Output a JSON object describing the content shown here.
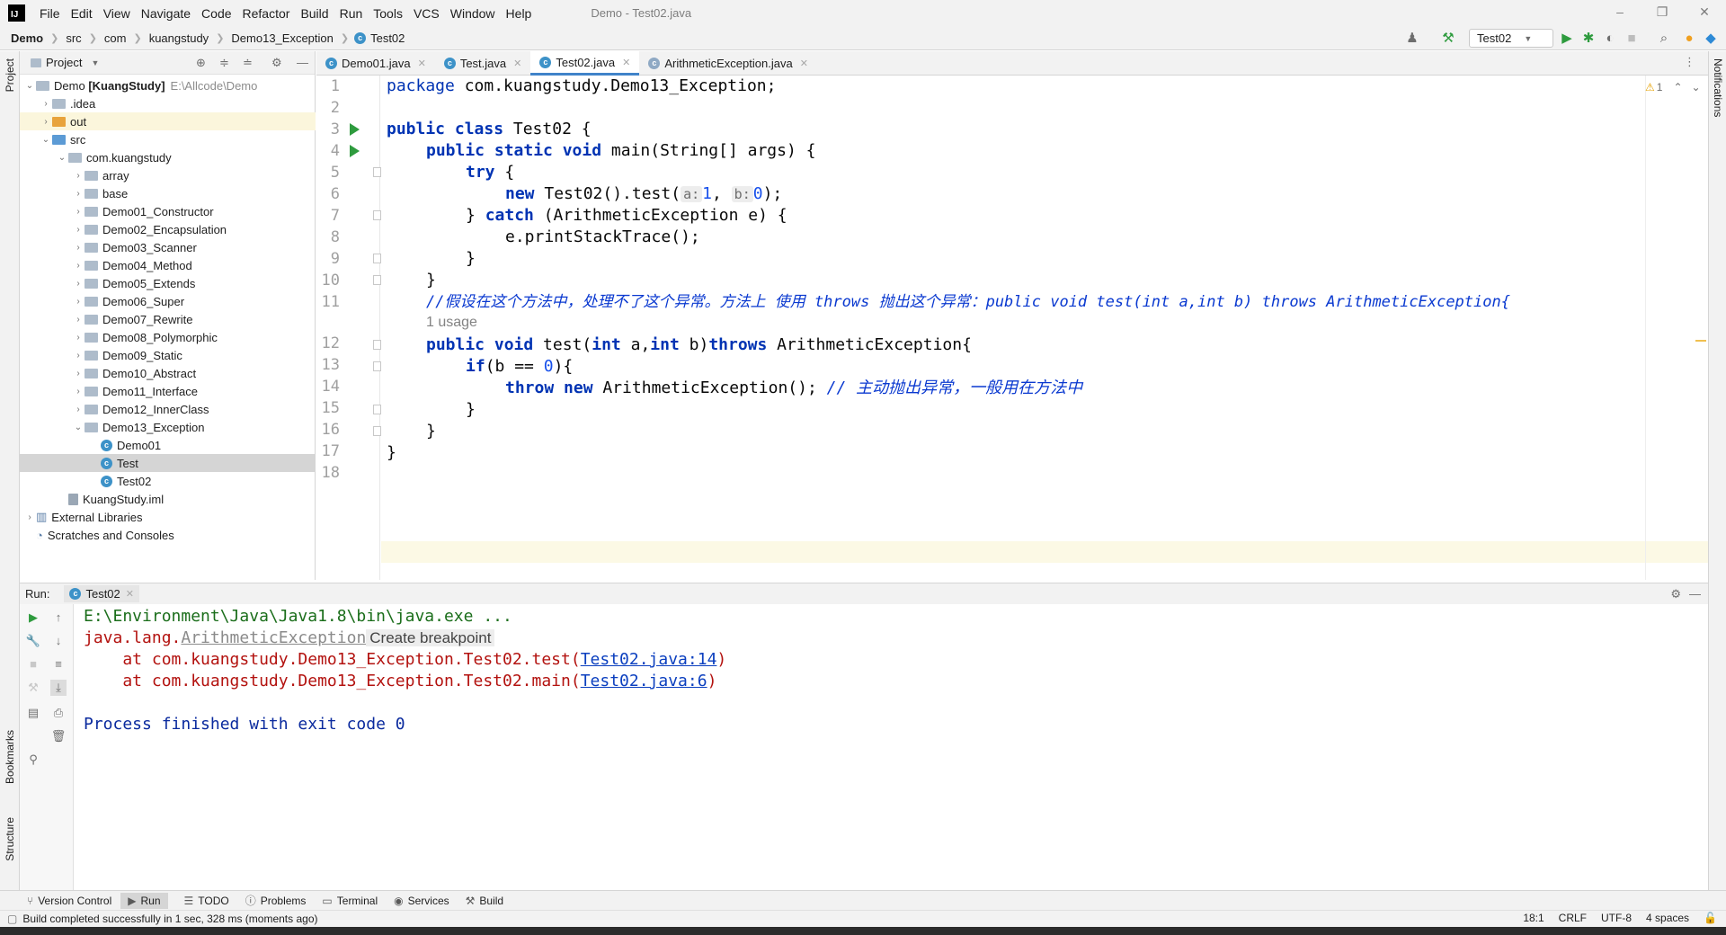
{
  "menu": {
    "items": [
      "File",
      "Edit",
      "View",
      "Navigate",
      "Code",
      "Refactor",
      "Build",
      "Run",
      "Tools",
      "VCS",
      "Window",
      "Help"
    ],
    "title": "Demo - Test02.java"
  },
  "breadcrumbs": [
    "Demo",
    "src",
    "com",
    "kuangstudy",
    "Demo13_Exception",
    "Test02"
  ],
  "toolbar": {
    "run_config": "Test02"
  },
  "left_strip": {
    "project": "Project",
    "bookmarks": "Bookmarks",
    "structure": "Structure"
  },
  "right_strip": {
    "notifications": "Notifications"
  },
  "project": {
    "header": "Project",
    "root": {
      "name": "Demo",
      "module": "[KuangStudy]",
      "path": "E:\\Allcode\\Demo"
    },
    "tree": [
      {
        "label": ".idea",
        "level": 1,
        "kind": "folder-gray",
        "arrow": "›"
      },
      {
        "label": "out",
        "level": 1,
        "kind": "folder-orange",
        "arrow": "›"
      },
      {
        "label": "src",
        "level": 1,
        "kind": "folder-blue",
        "arrow": "⌄"
      },
      {
        "label": "com.kuangstudy",
        "level": 2,
        "kind": "folder-gray",
        "arrow": "⌄"
      },
      {
        "label": "array",
        "level": 3,
        "kind": "folder-gray",
        "arrow": "›"
      },
      {
        "label": "base",
        "level": 3,
        "kind": "folder-gray",
        "arrow": "›"
      },
      {
        "label": "Demo01_Constructor",
        "level": 3,
        "kind": "folder-gray",
        "arrow": "›"
      },
      {
        "label": "Demo02_Encapsulation",
        "level": 3,
        "kind": "folder-gray",
        "arrow": "›"
      },
      {
        "label": "Demo03_Scanner",
        "level": 3,
        "kind": "folder-gray",
        "arrow": "›"
      },
      {
        "label": "Demo04_Method",
        "level": 3,
        "kind": "folder-gray",
        "arrow": "›"
      },
      {
        "label": "Demo05_Extends",
        "level": 3,
        "kind": "folder-gray",
        "arrow": "›"
      },
      {
        "label": "Demo06_Super",
        "level": 3,
        "kind": "folder-gray",
        "arrow": "›"
      },
      {
        "label": "Demo07_Rewrite",
        "level": 3,
        "kind": "folder-gray",
        "arrow": "›"
      },
      {
        "label": "Demo08_Polymorphic",
        "level": 3,
        "kind": "folder-gray",
        "arrow": "›"
      },
      {
        "label": "Demo09_Static",
        "level": 3,
        "kind": "folder-gray",
        "arrow": "›"
      },
      {
        "label": "Demo10_Abstract",
        "level": 3,
        "kind": "folder-gray",
        "arrow": "›"
      },
      {
        "label": "Demo11_Interface",
        "level": 3,
        "kind": "folder-gray",
        "arrow": "›"
      },
      {
        "label": "Demo12_InnerClass",
        "level": 3,
        "kind": "folder-gray",
        "arrow": "›"
      },
      {
        "label": "Demo13_Exception",
        "level": 3,
        "kind": "folder-gray",
        "arrow": "⌄"
      },
      {
        "label": "Demo01",
        "level": 4,
        "kind": "class",
        "arrow": ""
      },
      {
        "label": "Test",
        "level": 4,
        "kind": "class",
        "arrow": "",
        "selected": true
      },
      {
        "label": "Test02",
        "level": 4,
        "kind": "class",
        "arrow": ""
      },
      {
        "label": "KuangStudy.iml",
        "level": 2,
        "kind": "file",
        "arrow": ""
      },
      {
        "label": "External Libraries",
        "level": 0,
        "kind": "lib",
        "arrow": "›"
      },
      {
        "label": "Scratches and Consoles",
        "level": 0,
        "kind": "scratch",
        "arrow": ""
      }
    ]
  },
  "editor": {
    "tabs": [
      {
        "label": "Demo01.java",
        "active": false
      },
      {
        "label": "Test.java",
        "active": false
      },
      {
        "label": "Test02.java",
        "active": true
      },
      {
        "label": "ArithmeticException.java",
        "active": false
      }
    ],
    "warning_count": "1",
    "line_numbers": [
      "1",
      "2",
      "3",
      "4",
      "5",
      "6",
      "7",
      "8",
      "9",
      "10",
      "11",
      "12",
      "13",
      "14",
      "15",
      "16",
      "17",
      "18"
    ],
    "code": {
      "l1_kw": "package",
      "l1_rest": " com.kuangstudy.Demo13_Exception;",
      "l3_kw": "public class",
      "l3_rest": " Test02 {",
      "l4_kw": "public static void",
      "l4_rest": " main(String[] args) {",
      "l5_kw": "try",
      "l5_rest": " {",
      "l6_kw": "new",
      "l6_a": " Test02().test(",
      "l6_hint_a": "a:",
      "l6_num1": "1",
      "l6_comma": ", ",
      "l6_hint_b": "b:",
      "l6_num2": "0",
      "l6_end": ");",
      "l7_a": "} ",
      "l7_kw": "catch",
      "l7_rest": " (ArithmeticException e) {",
      "l8": "e.printStackTrace();",
      "l9": "}",
      "l10": "}",
      "l11_comment": "//假设在这个方法中，处理不了这个异常。方法上 使用 throws 抛出这个异常：public void test(int a,int b) throws ArithmeticException{",
      "usage": "1 usage",
      "l12_kw": "public void",
      "l12_a": " test(",
      "l12_kw2": "int",
      "l12_b": " a,",
      "l12_kw3": "int",
      "l12_c": " b)",
      "l12_kw4": "throws",
      "l12_d": " ArithmeticException{",
      "l13_kw": "if",
      "l13_a": "(b == ",
      "l13_num": "0",
      "l13_b": "){",
      "l14_kw": "throw new",
      "l14_a": " ArithmeticException(); ",
      "l14_cmt": "// 主动抛出异常，一般用在方法中",
      "l15": "}",
      "l16": "}",
      "l17": "}"
    }
  },
  "run": {
    "label": "Run:",
    "tab": "Test02",
    "cmd": "E:\\Environment\\Java\\Java1.8\\bin\\java.exe ...",
    "exc_prefix": "java.lang.",
    "exc_name": "ArithmeticException",
    "exc_hint": "Create breakpoint",
    "trace1_pre": "    at com.kuangstudy.Demo13_Exception.Test02.test(",
    "trace1_link": "Test02.java:14",
    "trace2_pre": "    at com.kuangstudy.Demo13_Exception.Test02.main(",
    "trace2_link": "Test02.java:6",
    "close_paren": ")",
    "finished": "Process finished with exit code 0"
  },
  "bottom_tools": [
    "Version Control",
    "Run",
    "TODO",
    "Problems",
    "Terminal",
    "Services",
    "Build"
  ],
  "status": {
    "message": "Build completed successfully in 1 sec, 328 ms (moments ago)",
    "position": "18:1",
    "line_sep": "CRLF",
    "encoding": "UTF-8",
    "indent": "4 spaces"
  },
  "colors": {
    "accent": "#4083c9",
    "keyword": "#0033b3",
    "comment": "#0a39d0",
    "error": "#b3120f",
    "run_green": "#2e9b3e"
  }
}
